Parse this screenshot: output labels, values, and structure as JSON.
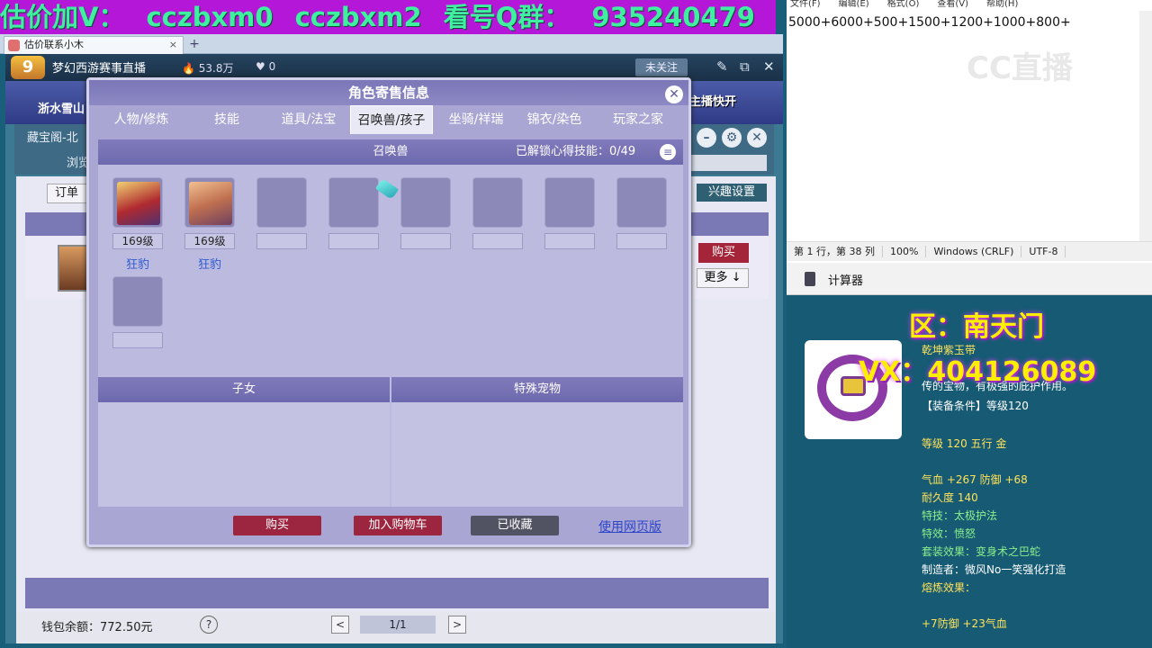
{
  "banner": {
    "part1": "估价加V：",
    "part2": "cczbxm0",
    "part3": "cczbxm2",
    "part4": "看号Q群：",
    "part5": "935240479"
  },
  "browser_tab": {
    "title": "估价联系小木",
    "close": "×",
    "new": "+"
  },
  "live": {
    "channel_title": "梦幻西游赛事直播",
    "heat": "53.8万",
    "likes": "0",
    "follow_label": "未关注"
  },
  "game": {
    "category": "浙水雪山",
    "promo": "主播快开",
    "cbg": "藏宝阁-北",
    "browse": "浏览",
    "order_label": "订单",
    "interest_label": "兴趣设置",
    "buy_label": "购买",
    "more_label": "更多",
    "wallet_label": "钱包余额：772.50元",
    "help": "?",
    "page": "1/1",
    "prev": "<",
    "next": ">"
  },
  "modal": {
    "title": "角色寄售信息",
    "close": "✕",
    "tabs": [
      "人物/修炼",
      "技能",
      "道具/法宝",
      "召唤兽/孩子",
      "坐骑/祥瑞",
      "锦衣/染色",
      "玩家之家"
    ],
    "active_tab": "召唤兽/孩子",
    "section_title": "召唤兽",
    "skill_unlock": "已解锁心得技能：0/49",
    "pets": [
      {
        "level": "169级",
        "name": "狂豹"
      },
      {
        "level": "169级",
        "name": "狂豹"
      }
    ],
    "children_label": "子女",
    "special_label": "特殊宠物",
    "buy_button": "购买",
    "cart_button": "加入购物车",
    "collected_button": "已收藏",
    "web_link": "使用网页版"
  },
  "notepad": {
    "menu": [
      "文件(F)",
      "编辑(E)",
      "格式(O)",
      "查看(V)",
      "帮助(H)"
    ],
    "content": "5000+6000+500+1500+1200+1000+800+",
    "status": [
      "第 1 行，第 38 列",
      "100%",
      "Windows (CRLF)",
      "UTF-8"
    ],
    "watermark": "CC直播"
  },
  "calculator": {
    "label": "计算器"
  },
  "item": {
    "region": "区：南天门",
    "vx": "VX：404126089",
    "name": "乾坤紫玉带",
    "desc": "传的宝物，有极强的庇护作用。",
    "req": "【装备条件】等级120",
    "level": "等级 120  五行 金",
    "stats": "气血 +267 防御 +68",
    "durability": "耐久度 140",
    "special_skill": "特技：太极护法",
    "special_effect": "特效：愤怒",
    "set_effect": "套装效果：变身术之巴蛇",
    "maker": "制造者：微风No一笑强化打造",
    "refine_label": "熔炼效果：",
    "refine": "+7防御 +23气血"
  }
}
